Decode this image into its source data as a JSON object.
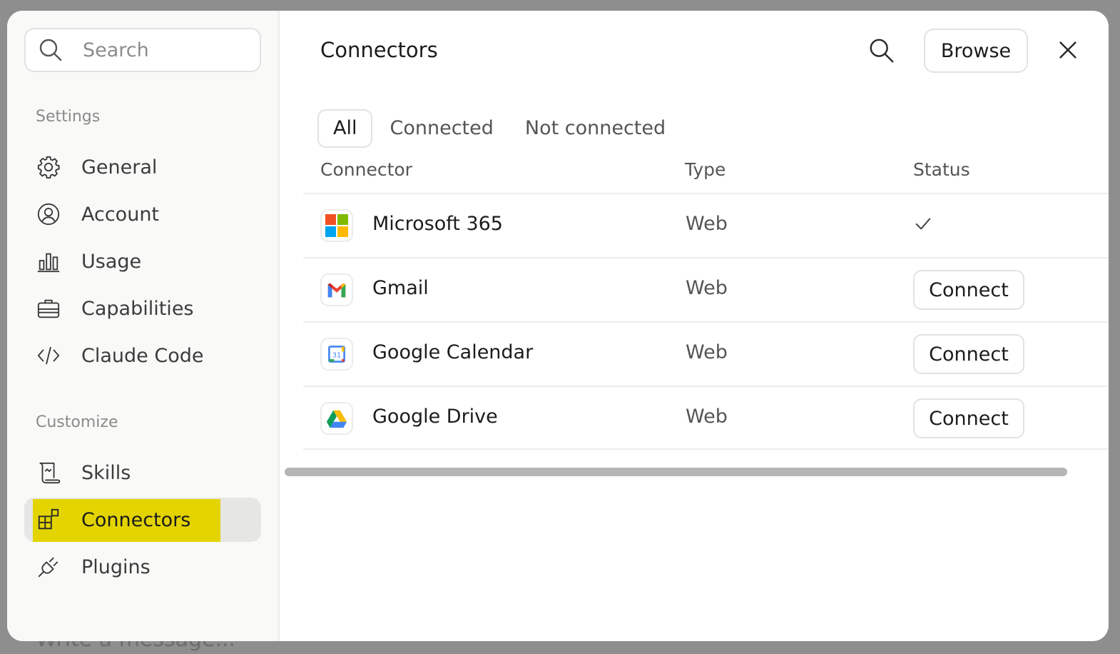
{
  "backdrop": {
    "composer_placeholder": "Write a message..."
  },
  "sidebar": {
    "search": {
      "placeholder": "Search",
      "icon": "search-icon"
    },
    "settings_label": "Settings",
    "settings_items": [
      {
        "label": "General",
        "icon": "gear-icon"
      },
      {
        "label": "Account",
        "icon": "user-circle-icon"
      },
      {
        "label": "Usage",
        "icon": "bar-chart-icon"
      },
      {
        "label": "Capabilities",
        "icon": "briefcase-icon"
      },
      {
        "label": "Claude Code",
        "icon": "code-icon"
      }
    ],
    "customize_label": "Customize",
    "customize_items": [
      {
        "label": "Skills",
        "icon": "scroll-icon"
      },
      {
        "label": "Connectors",
        "icon": "connectors-icon",
        "active": true,
        "highlight_color": "#e3d400"
      },
      {
        "label": "Plugins",
        "icon": "plug-icon"
      }
    ]
  },
  "main": {
    "title": "Connectors",
    "browse_label": "Browse",
    "tabs": [
      {
        "label": "All",
        "active": true
      },
      {
        "label": "Connected"
      },
      {
        "label": "Not connected"
      }
    ],
    "columns": {
      "connector": "Connector",
      "type": "Type",
      "status": "Status"
    },
    "rows": [
      {
        "name": "Microsoft 365",
        "type": "Web",
        "status": "connected",
        "icon": "microsoft-365-logo"
      },
      {
        "name": "Gmail",
        "type": "Web",
        "status": "Connect",
        "icon": "gmail-logo"
      },
      {
        "name": "Google Calendar",
        "type": "Web",
        "status": "Connect",
        "icon": "google-calendar-logo",
        "calendar_day": "31"
      },
      {
        "name": "Google Drive",
        "type": "Web",
        "status": "Connect",
        "icon": "google-drive-logo"
      }
    ]
  }
}
